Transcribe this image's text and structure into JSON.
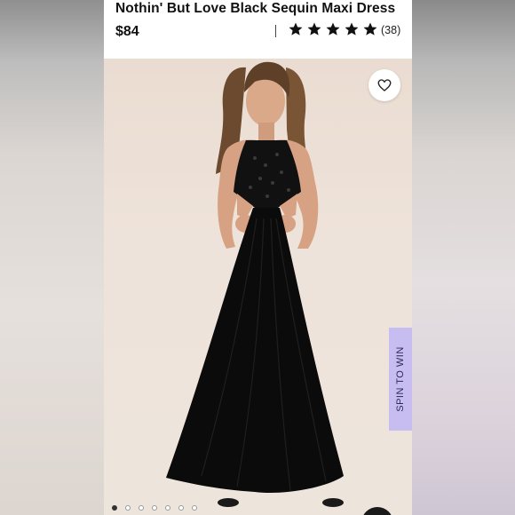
{
  "product": {
    "title": "Nothin' But Love Black Sequin Maxi Dress",
    "price": "$84",
    "rating_stars": 5,
    "review_count": "(38)"
  },
  "icons": {
    "star": "star-icon",
    "wishlist": "heart-icon"
  },
  "promo": {
    "spin_label": "SPIN TO WIN"
  },
  "carousel": {
    "total_slides": 7,
    "active_index": 0
  },
  "colors": {
    "star": "#111111",
    "spin_tab_bg": "#c8bdf0",
    "dress": "#0b0b0b"
  }
}
